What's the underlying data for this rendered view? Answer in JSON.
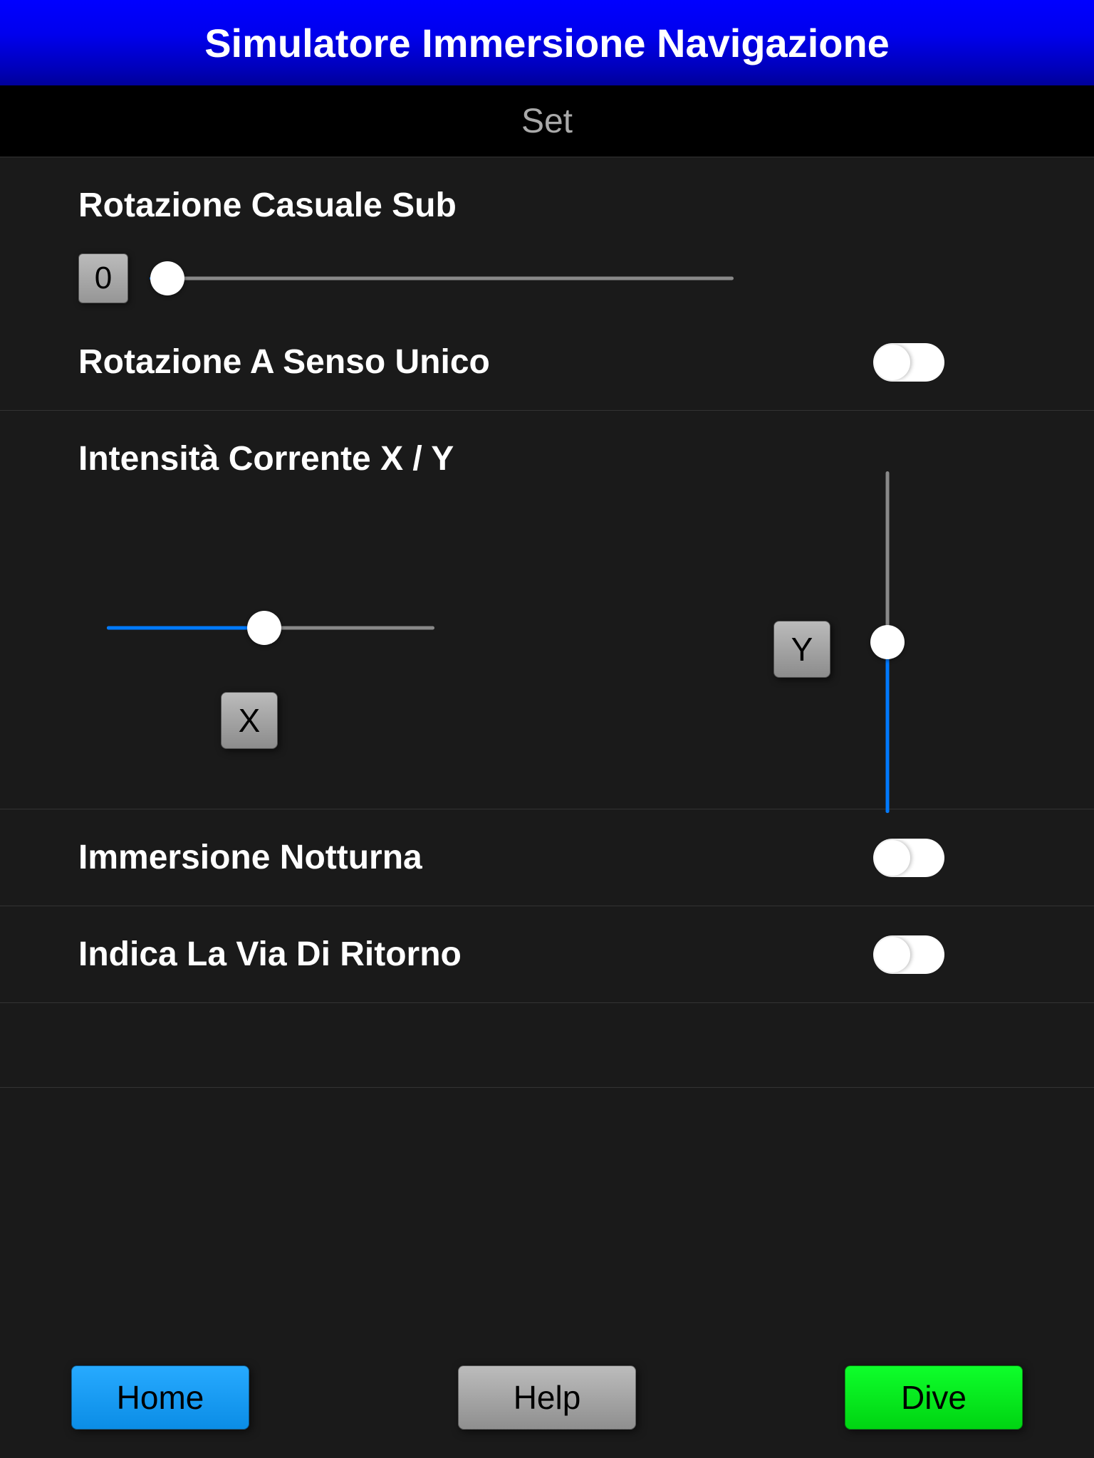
{
  "header": {
    "title": "Simulatore Immersione Navigazione",
    "subtitle": "Set"
  },
  "settings": {
    "random_rotation": {
      "label": "Rotazione Casuale Sub",
      "value": "0",
      "slider_percent": 3
    },
    "one_way_rotation": {
      "label": "Rotazione A Senso Unico",
      "on": false
    },
    "current_intensity": {
      "label": "Intensità Corrente X / Y",
      "x_label": "X",
      "y_label": "Y",
      "x_percent": 48,
      "y_percent": 50
    },
    "night_dive": {
      "label": "Immersione Notturna",
      "on": false
    },
    "return_path": {
      "label": "Indica La Via Di Ritorno",
      "on": false
    }
  },
  "footer": {
    "home": "Home",
    "help": "Help",
    "dive": "Dive"
  }
}
